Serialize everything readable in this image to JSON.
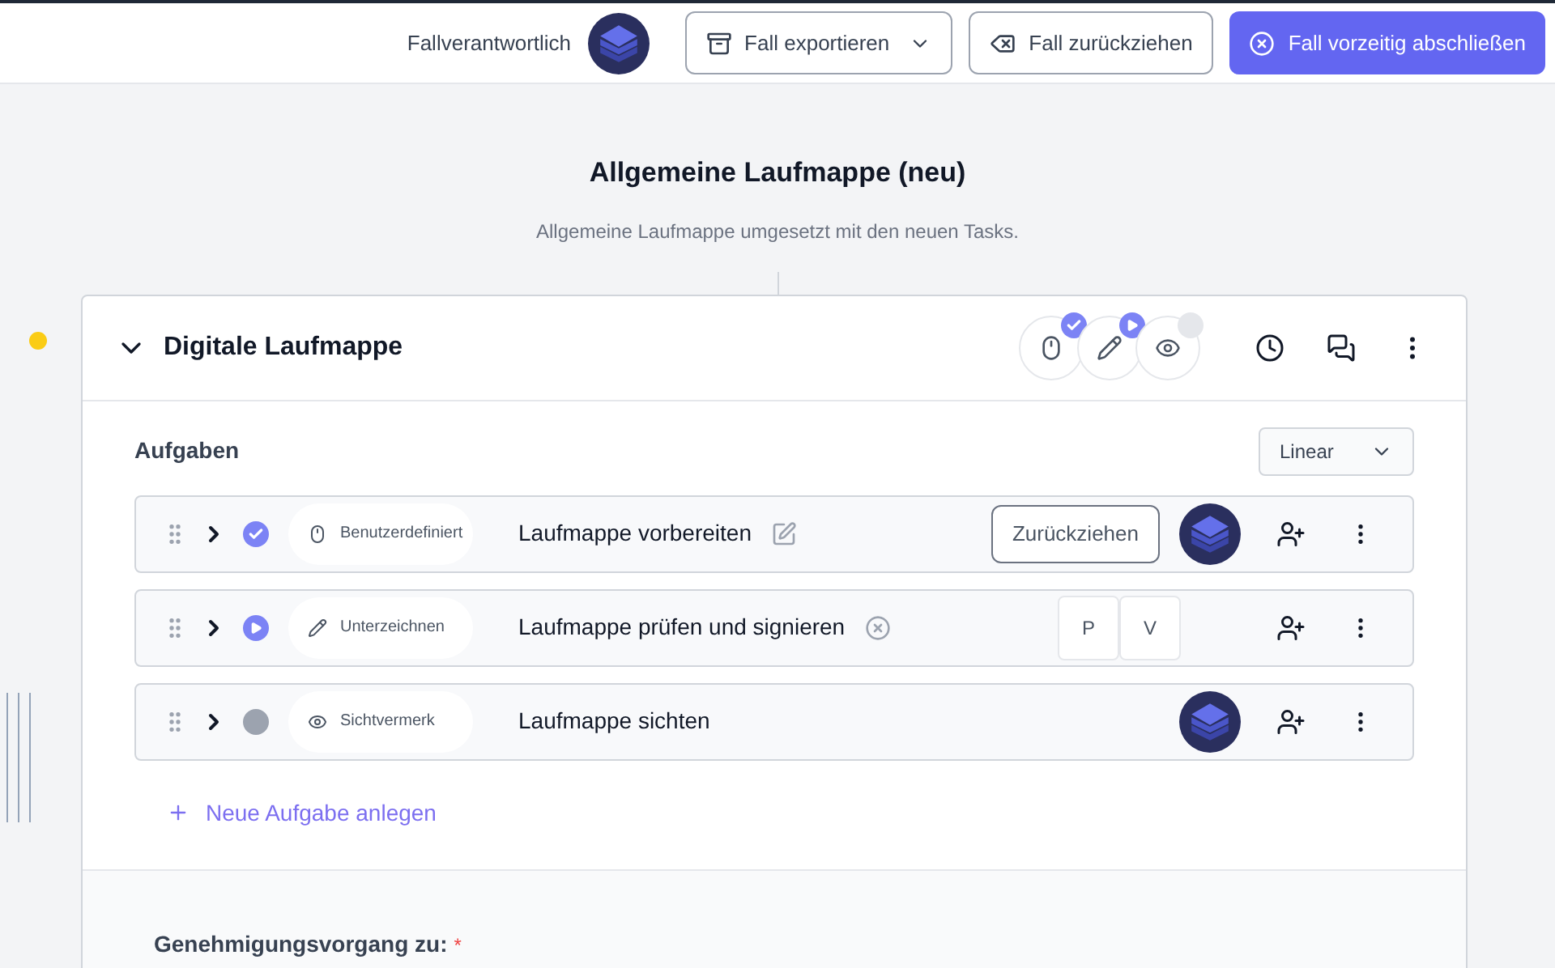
{
  "header": {
    "owner_label": "Fallverantwortlich",
    "buttons": [
      {
        "kind": "export",
        "label": "Fall exportieren"
      },
      {
        "kind": "withdraw",
        "label": "Fall zurückziehen"
      },
      {
        "kind": "close",
        "label": "Fall vorzeitig abschließen"
      }
    ]
  },
  "title": "Allgemeine Laufmappe (neu)",
  "subtitle": "Allgemeine Laufmappe umgesetzt mit den neuen Tasks.",
  "card": {
    "title": "Digitale Laufmappe",
    "expanded": true,
    "steps": [
      {
        "kind": "custom",
        "completed": true,
        "running": false
      },
      {
        "kind": "sign",
        "completed": false,
        "running": true
      },
      {
        "kind": "view",
        "completed": false,
        "running": false
      }
    ],
    "section_label": "Aufgaben",
    "mode": "Linear",
    "tasks": [
      {
        "kind": "custom",
        "completed": true,
        "running": false,
        "type": "Benutzerdefiniert",
        "title": "Laufmappe vorbereiten",
        "editable": true,
        "cancelable": false,
        "right": {
          "kind": "withdraw",
          "label": "Zurückziehen"
        }
      },
      {
        "kind": "sign",
        "completed": false,
        "running": true,
        "type": "Unterzeichnen",
        "title": "Laufmappe prüfen und signieren",
        "editable": false,
        "cancelable": true,
        "right": {
          "kind": "initials",
          "items": [
            "P",
            "V"
          ]
        }
      },
      {
        "kind": "view",
        "completed": false,
        "running": false,
        "type": "Sichtvermerk",
        "title": "Laufmappe sichten",
        "editable": false,
        "cancelable": false,
        "right": {
          "kind": "avatar"
        }
      }
    ],
    "add_label": "Neue Aufgabe anlegen",
    "footer_label": "Genehmigungsvorgang zu:",
    "required_mark": "*"
  }
}
